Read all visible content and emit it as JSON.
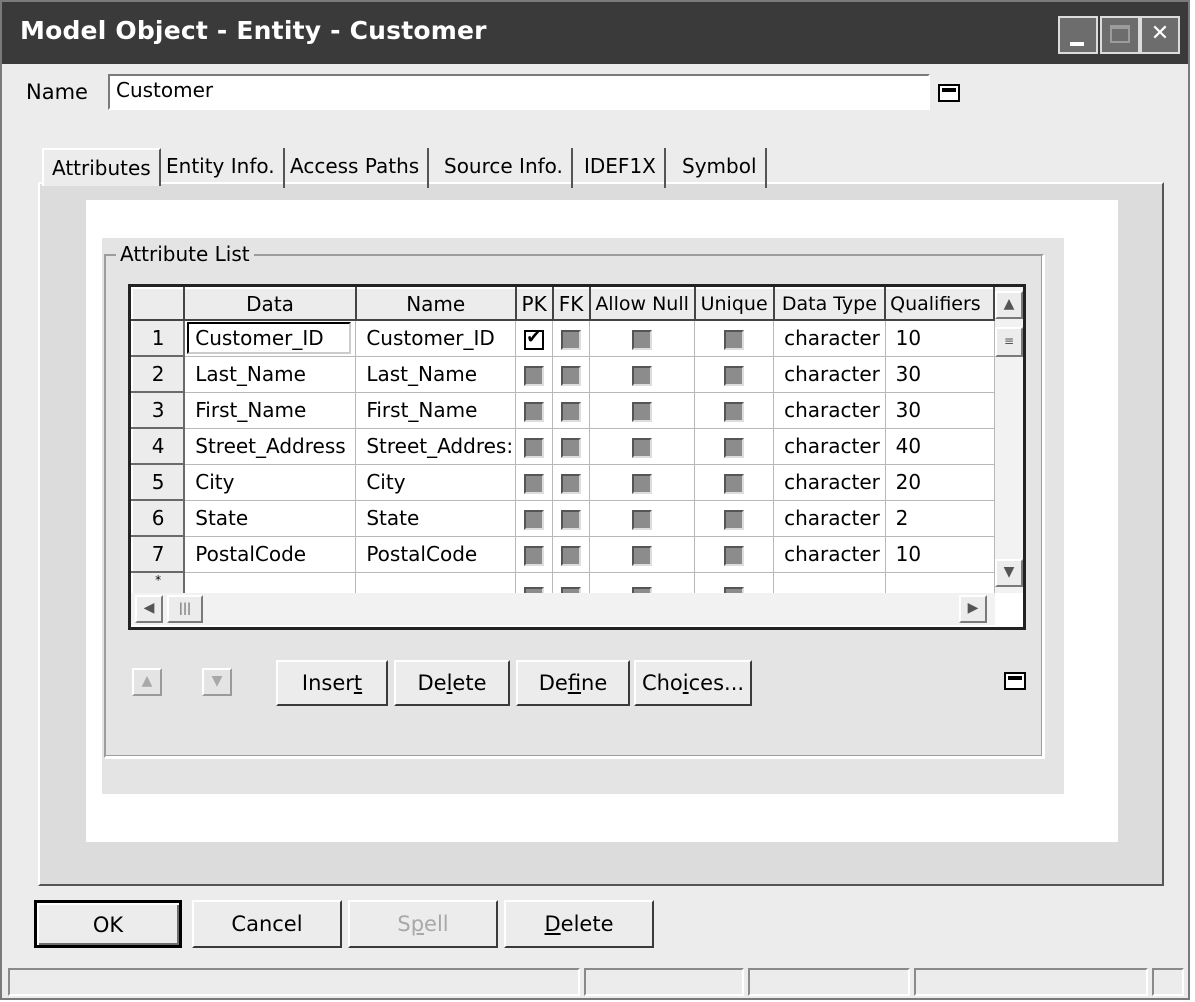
{
  "window": {
    "title": "Model Object - Entity - Customer",
    "controls": [
      "minimize-icon",
      "maximize-icon",
      "close-icon"
    ]
  },
  "name_field": {
    "label": "Name",
    "value": "Customer"
  },
  "tabs": [
    {
      "label": "Attributes",
      "selected": true
    },
    {
      "label": "Entity Info.",
      "selected": false
    },
    {
      "label": "Access Paths",
      "selected": false
    },
    {
      "label": "Source Info.",
      "selected": false
    },
    {
      "label": "IDEF1X",
      "selected": false
    },
    {
      "label": "Symbol",
      "selected": false
    }
  ],
  "attribute_list": {
    "group_label": "Attribute List",
    "columns": [
      "Data",
      "Name",
      "PK",
      "FK",
      "Allow Null",
      "Unique",
      "Data Type",
      "Qualifiers"
    ],
    "rows": [
      {
        "num": "1",
        "data": "Customer_ID",
        "name": "Customer_ID",
        "pk": true,
        "fk": false,
        "allow_null": false,
        "unique": false,
        "data_type": "character",
        "qualifiers": "10"
      },
      {
        "num": "2",
        "data": "Last_Name",
        "name": "Last_Name",
        "pk": false,
        "fk": false,
        "allow_null": false,
        "unique": false,
        "data_type": "character",
        "qualifiers": "30"
      },
      {
        "num": "3",
        "data": "First_Name",
        "name": "First_Name",
        "pk": false,
        "fk": false,
        "allow_null": false,
        "unique": false,
        "data_type": "character",
        "qualifiers": "30"
      },
      {
        "num": "4",
        "data": "Street_Address",
        "name": "Street_Addres:",
        "pk": false,
        "fk": false,
        "allow_null": false,
        "unique": false,
        "data_type": "character",
        "qualifiers": "40"
      },
      {
        "num": "5",
        "data": "City",
        "name": "City",
        "pk": false,
        "fk": false,
        "allow_null": false,
        "unique": false,
        "data_type": "character",
        "qualifiers": "20"
      },
      {
        "num": "6",
        "data": "State",
        "name": "State",
        "pk": false,
        "fk": false,
        "allow_null": false,
        "unique": false,
        "data_type": "character",
        "qualifiers": "2"
      },
      {
        "num": "7",
        "data": "PostalCode",
        "name": "PostalCode",
        "pk": false,
        "fk": false,
        "allow_null": false,
        "unique": false,
        "data_type": "character",
        "qualifiers": "10"
      }
    ],
    "new_row_marker": "*"
  },
  "list_buttons": {
    "move_up": "up-arrow-icon",
    "move_down": "down-arrow-icon",
    "insert_pre": "Inser",
    "insert_key": "t",
    "insert_post": "",
    "delete_pre": "De",
    "delete_key": "l",
    "delete_post": "ete",
    "define_pre": "De",
    "define_key": "f",
    "define_post": "ine",
    "choices_pre": "Cho",
    "choices_key": "i",
    "choices_post": "ces..."
  },
  "dialog_buttons": {
    "ok": "OK",
    "cancel": "Cancel",
    "spell_pre": "S",
    "spell_key": "p",
    "spell_post": "ell",
    "delete_key": "D",
    "delete_post": "elete"
  }
}
